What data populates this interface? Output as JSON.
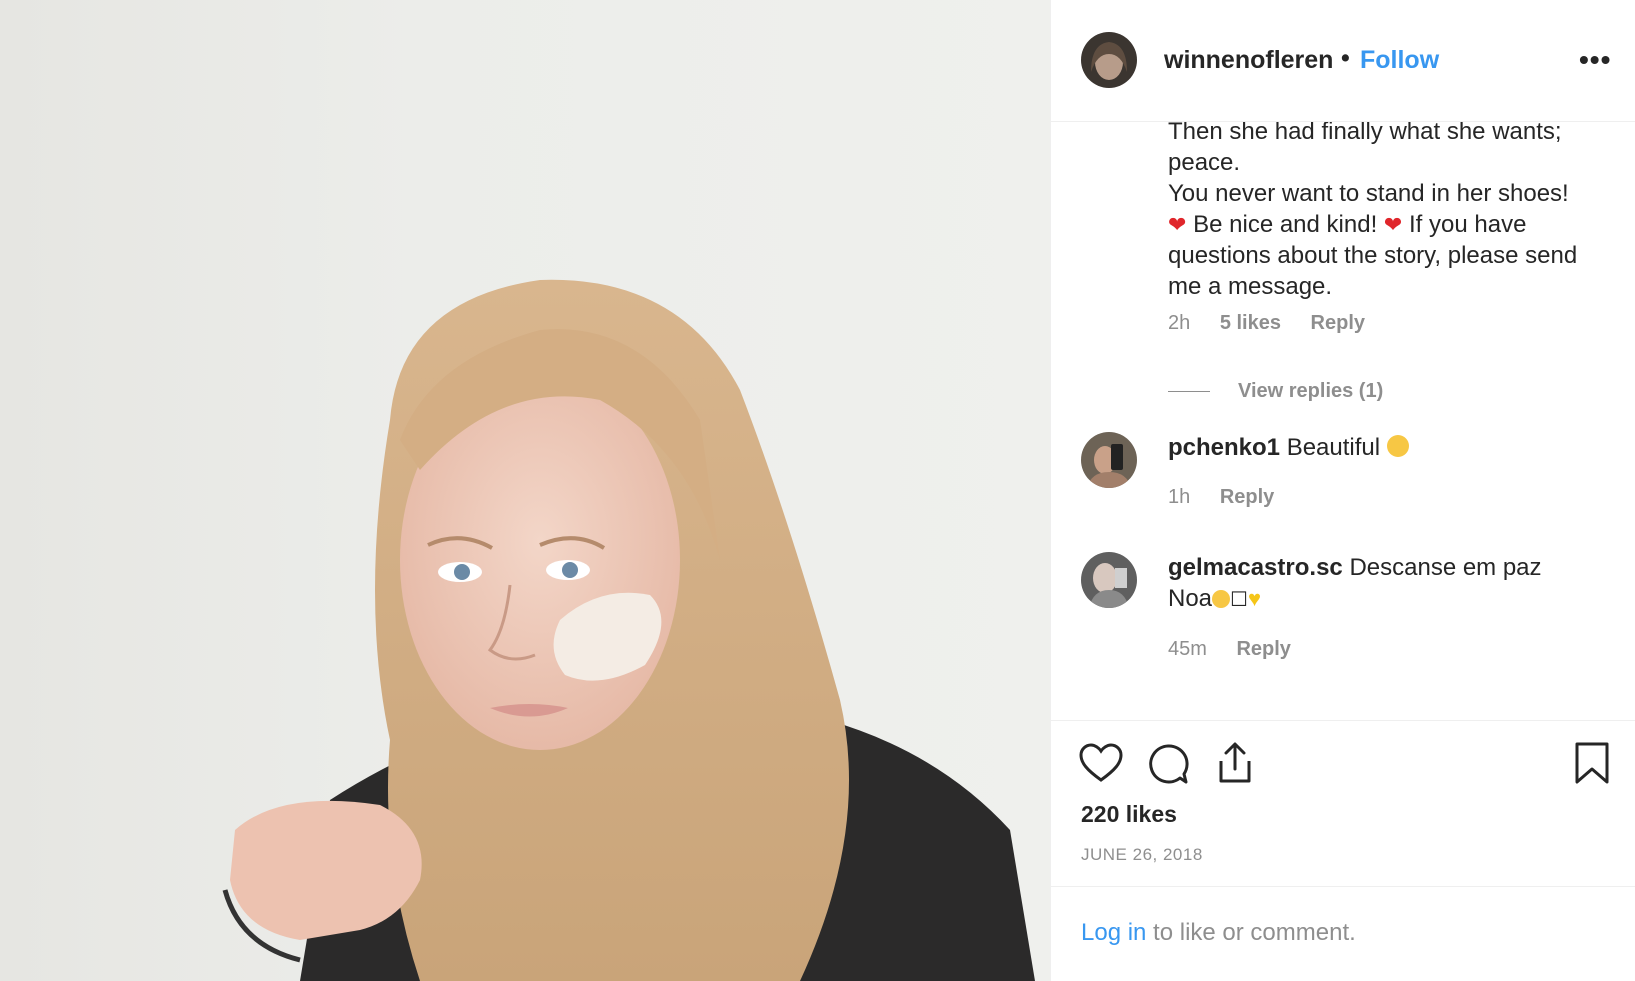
{
  "post": {
    "username": "winnenofleren",
    "separator": "•",
    "follow_label": "Follow",
    "more_label": "•••"
  },
  "caption": {
    "lines": [
      "Then she had finally what she wants;",
      "peace.",
      "You never want to stand in her shoes!",
      "Be nice and kind!",
      "If you have",
      "questions about the story, please send",
      "me a message."
    ],
    "time": "2h",
    "likes": "5 likes",
    "reply_label": "Reply",
    "view_replies": "View replies (1)"
  },
  "comments": [
    {
      "username": "pchenko1",
      "text": "Beautiful",
      "time": "1h",
      "reply_label": "Reply"
    },
    {
      "username": "gelmacastro.sc",
      "text_line1": "Descanse em paz",
      "text_line2": "Noa",
      "time": "45m",
      "reply_label": "Reply"
    }
  ],
  "actions": {
    "icons": [
      "heart-icon",
      "comment-icon",
      "share-icon",
      "bookmark-icon"
    ],
    "likes": "220 likes",
    "date": "JUNE 26, 2018"
  },
  "login_bar": {
    "login_label": "Log in",
    "rest": " to like or comment."
  },
  "colors": {
    "link_blue": "#3897f0",
    "meta_gray": "#8e8e8e",
    "text": "#262626",
    "heart_red": "#e0262b"
  }
}
